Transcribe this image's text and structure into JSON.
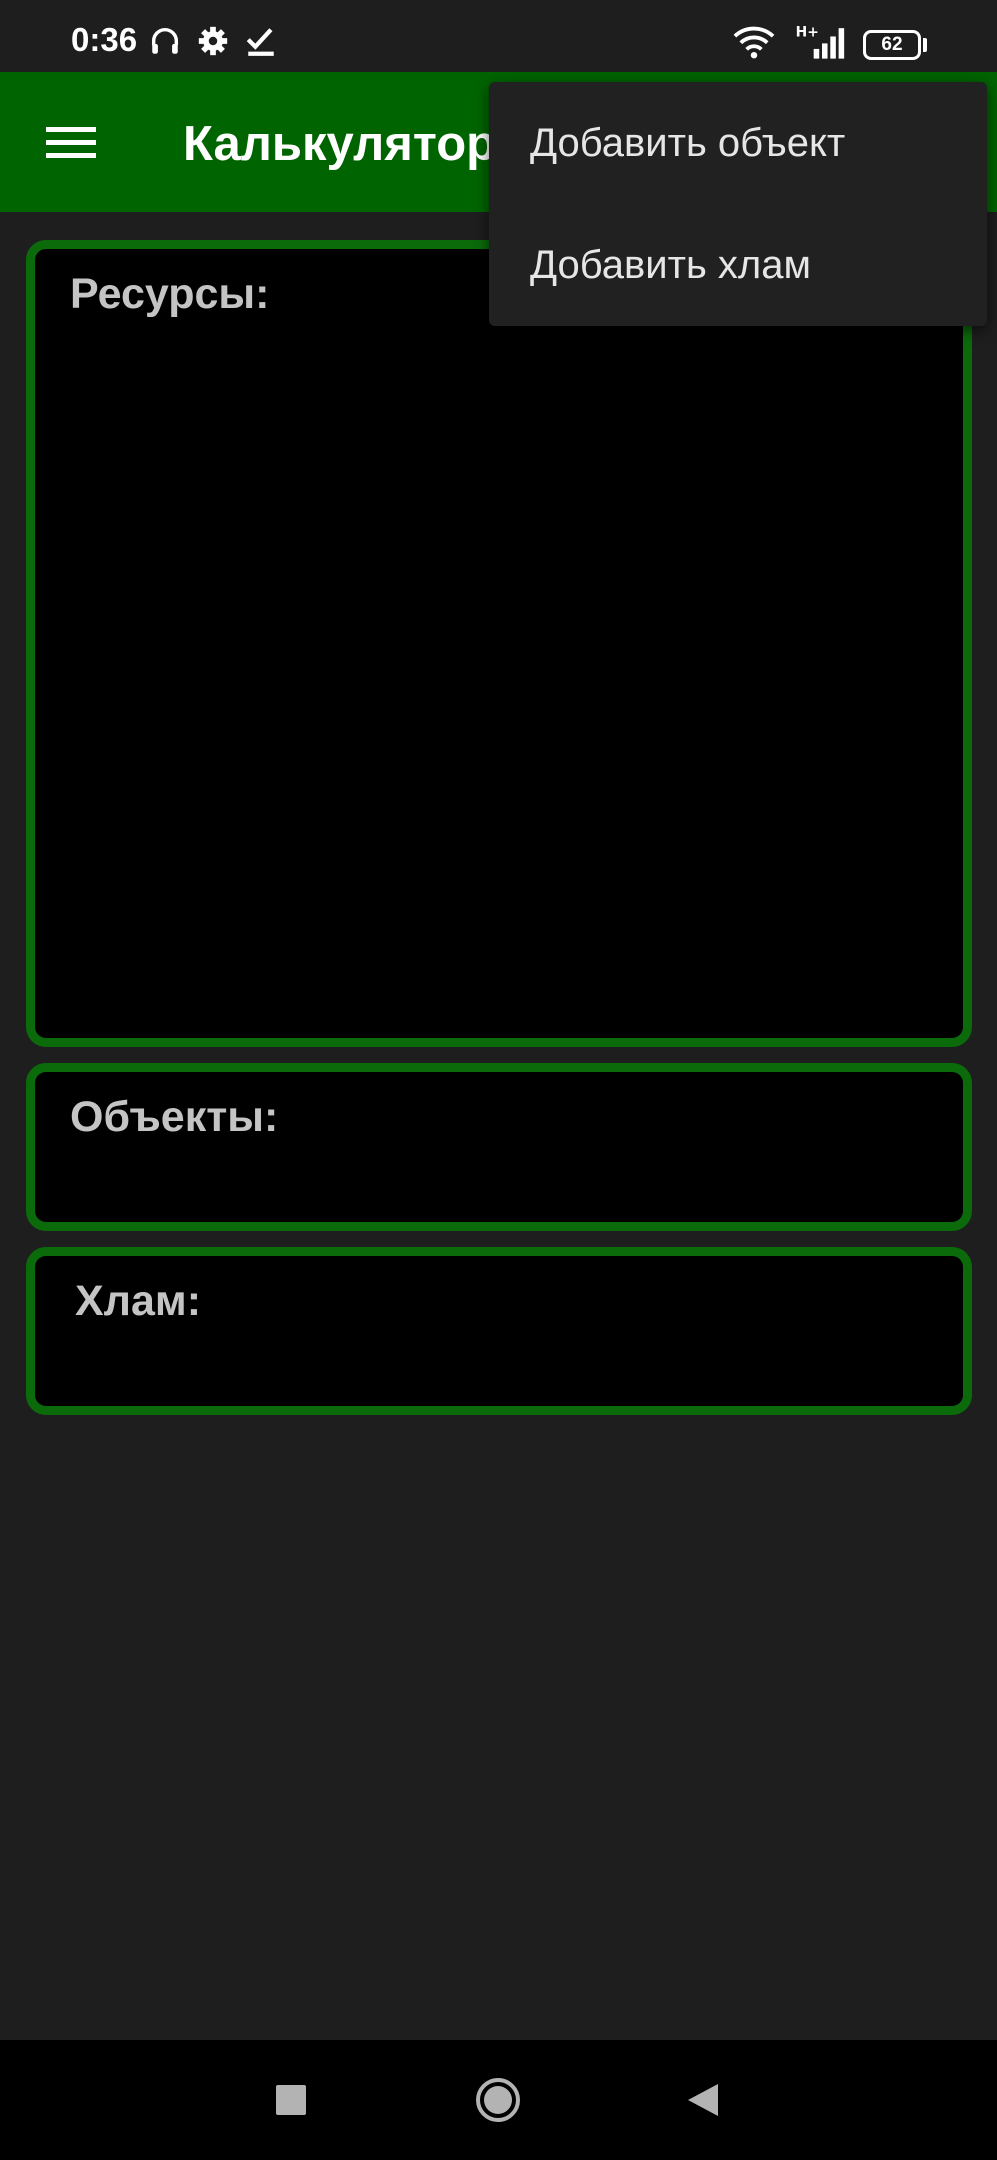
{
  "status_bar": {
    "time": "0:36",
    "battery": "62",
    "network": "H+",
    "icons": [
      "headset-icon",
      "gear-icon",
      "check-icon",
      "wifi-icon",
      "signal-icon",
      "battery-icon"
    ]
  },
  "app_bar": {
    "title": "Калькулятор",
    "background_color": "#006400"
  },
  "sections": {
    "resources_label": "Ресурсы:",
    "objects_label": "Объекты:",
    "junk_label": "Хлам:",
    "border_color": "#0b6b0b"
  },
  "menu": {
    "add_object": "Добавить объект",
    "add_junk": "Добавить хлам"
  },
  "nav_bar": {
    "icons": [
      "recents-icon",
      "home-icon",
      "back-icon"
    ]
  }
}
